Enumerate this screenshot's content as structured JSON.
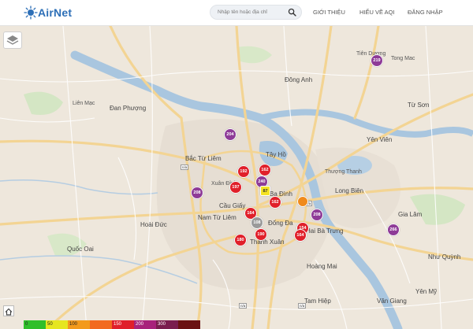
{
  "header": {
    "logo_text": "AirNet",
    "search_placeholder": "Nhập tên hoặc địa chỉ",
    "nav": [
      "GIỚI THIỆU",
      "HIỂU VỀ AQI",
      "ĐĂNG NHẬP"
    ]
  },
  "places": [
    "Đông Anh",
    "Đan Phượng",
    "Từ Sơn",
    "Tây Hồ",
    "Bắc Từ Liêm",
    "Yên Viên",
    "Ba Đình",
    "Long Biên",
    "Cầu Giấy",
    "Nam Từ Liêm",
    "Đống Đa",
    "Gia Lâm",
    "Hoài Đức",
    "Hai Bà Trưng",
    "Quốc Oai",
    "Thanh Xuân",
    "Hoàng Mai",
    "Như Quỳnh",
    "Văn Giang",
    "Tam Hiệp",
    "Yên Mỹ"
  ],
  "small_places": [
    "Tiên Dương",
    "Tong Mac",
    "Liên Mạc",
    "Xuân Đỉnh",
    "Thượng Thanh"
  ],
  "stations": [
    {
      "aqi": "219",
      "color": "#8e3b97"
    },
    {
      "aqi": "204",
      "color": "#8e3b97"
    },
    {
      "aqi": "192",
      "color": "#e0202a"
    },
    {
      "aqi": "162",
      "color": "#e0202a"
    },
    {
      "aqi": "240",
      "color": "#8e3b97"
    },
    {
      "aqi": "197",
      "color": "#e0202a"
    },
    {
      "aqi": "87",
      "color": "#f4e324"
    },
    {
      "aqi": "208",
      "color": "#8e3b97"
    },
    {
      "aqi": "162",
      "color": "#e0202a"
    },
    {
      "aqi": "164",
      "color": "#e0202a"
    },
    {
      "aqi": "108",
      "color": "#9a9a9a"
    },
    {
      "aqi": "208",
      "color": "#8e3b97"
    },
    {
      "aqi": "154",
      "color": "#e0202a"
    },
    {
      "aqi": "164",
      "color": "#e0202a"
    },
    {
      "aqi": "266",
      "color": "#8e3b97"
    },
    {
      "aqi": "180",
      "color": "#e0202a"
    },
    {
      "aqi": "190",
      "color": "#e0202a"
    },
    {
      "aqi": "",
      "color": "#f08a1c"
    }
  ],
  "na_label": "n/a",
  "legend": [
    {
      "label": "0",
      "color": "#2fbf2a"
    },
    {
      "label": "50",
      "color": "#e6e61f"
    },
    {
      "label": "100",
      "color": "#f39a1c"
    },
    {
      "label": "",
      "color": "#f26a1f"
    },
    {
      "label": "150",
      "color": "#e0202a"
    },
    {
      "label": "200",
      "color": "#a8237b"
    },
    {
      "label": "300",
      "color": "#7a1e4e"
    },
    {
      "label": "",
      "color": "#6b1212"
    }
  ]
}
